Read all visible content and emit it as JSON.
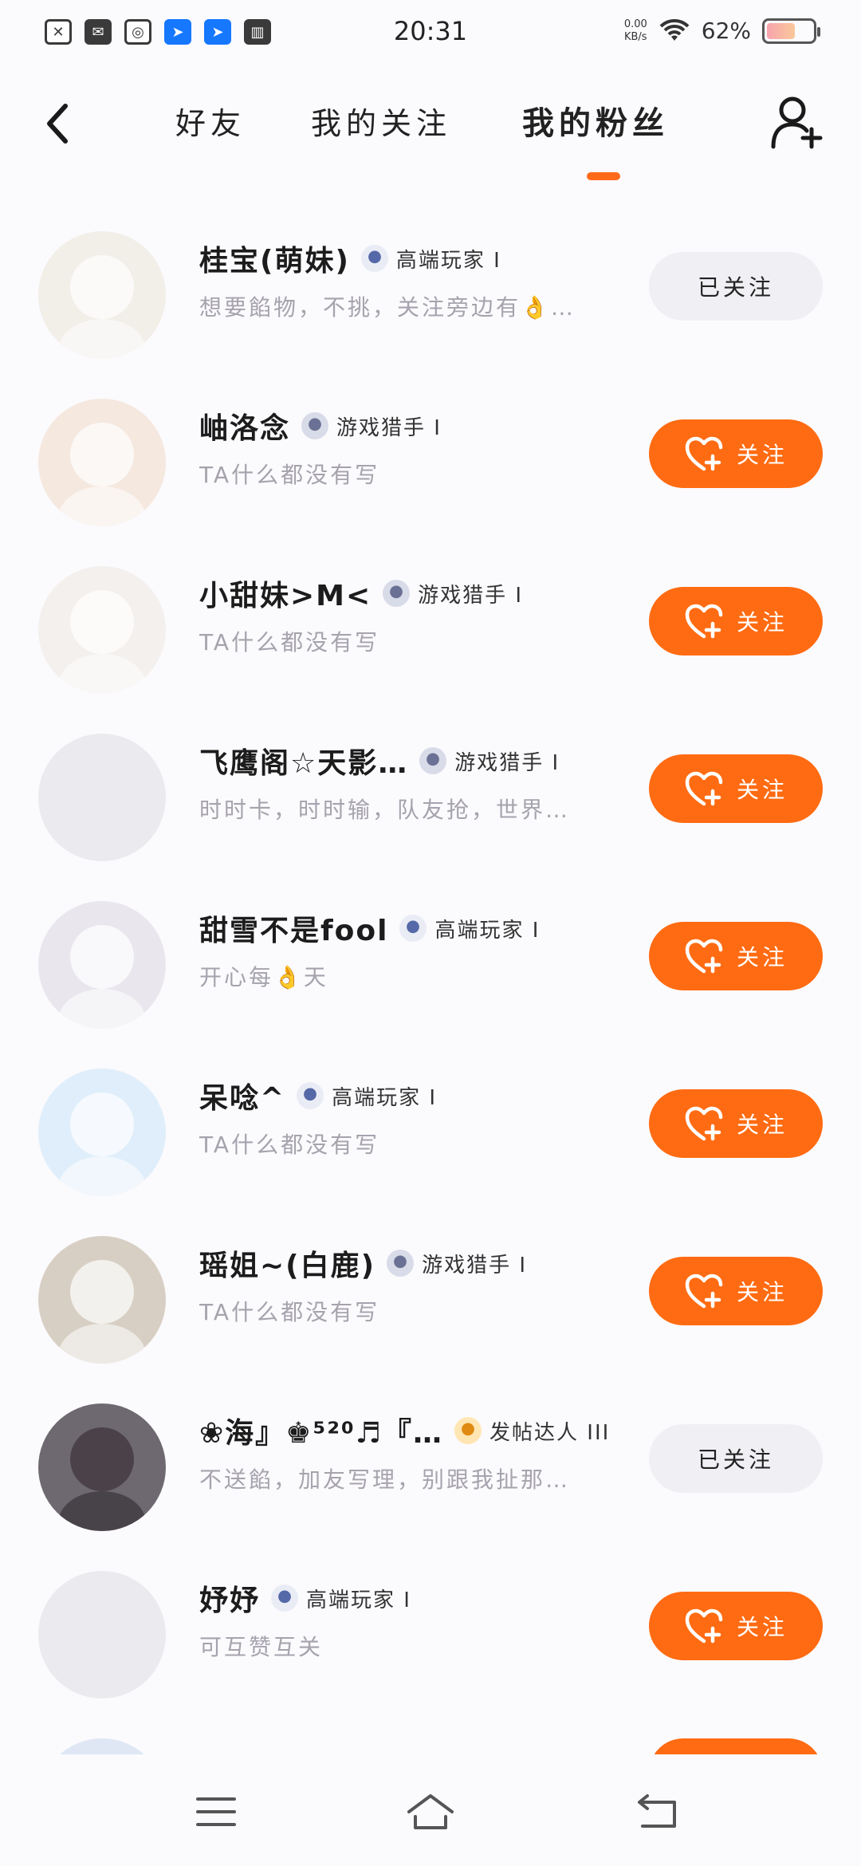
{
  "status_bar": {
    "time": "20:31",
    "net_speed": "0.00",
    "net_unit": "KB/s",
    "battery_pct": "62%",
    "battery_level": 0.62
  },
  "header": {
    "tabs": [
      {
        "label": "好友",
        "active": false
      },
      {
        "label": "我的关注",
        "active": false
      },
      {
        "label": "我的粉丝",
        "active": true
      }
    ],
    "accent_color": "#ff6b12"
  },
  "fans": [
    {
      "name": "桂宝(萌妹)",
      "badge": "高端玩家 I",
      "badge_icon": "robot-badge-icon",
      "signature": "想要餡物，不挑，关注旁边有👌…",
      "followed": true,
      "button": "已关注"
    },
    {
      "name": "岫洛念",
      "badge": "游戏猎手 I",
      "badge_icon": "hunter-badge-icon",
      "signature": "TA什么都没有写",
      "followed": false,
      "button": "关注"
    },
    {
      "name": "小甜妹>M<",
      "badge": "游戏猎手 I",
      "badge_icon": "hunter-badge-icon",
      "signature": "TA什么都没有写",
      "followed": false,
      "button": "关注"
    },
    {
      "name": "飞鹰阁☆天影…",
      "badge": "游戏猎手 I",
      "badge_icon": "hunter-badge-icon",
      "signature": "时时卡，时时输，队友抢，世界…",
      "followed": false,
      "button": "关注"
    },
    {
      "name": "甜雪不是fool",
      "badge": "高端玩家 I",
      "badge_icon": "robot-badge-icon",
      "signature": "开心每👌天",
      "followed": false,
      "button": "关注"
    },
    {
      "name": "呆唸^",
      "badge": "高端玩家 I",
      "badge_icon": "robot-badge-icon",
      "signature": "TA什么都没有写",
      "followed": false,
      "button": "关注"
    },
    {
      "name": "瑶姐~(白鹿)",
      "badge": "游戏猎手 I",
      "badge_icon": "hunter-badge-icon",
      "signature": "TA什么都没有写",
      "followed": false,
      "button": "关注"
    },
    {
      "name": "❀海』♚⁵²⁰♬『…",
      "badge": "发帖达人 III",
      "badge_icon": "poster-badge-icon",
      "signature": "不送餡，加友写理，别跟我扯那…",
      "followed": true,
      "button": "已关注"
    },
    {
      "name": "妤妤",
      "badge": "高端玩家 I",
      "badge_icon": "robot-badge-icon",
      "signature": "可互赞互关",
      "followed": false,
      "button": "关注"
    }
  ],
  "nav_bar": {
    "menu_icon": "menu-icon",
    "home_icon": "home-icon",
    "back_icon": "back-icon"
  }
}
